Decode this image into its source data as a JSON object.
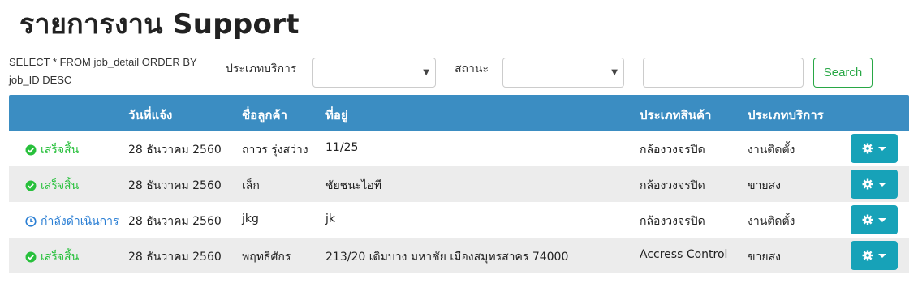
{
  "page": {
    "title": "รายการงาน Support"
  },
  "filters": {
    "sql": "SELECT * FROM job_detail ORDER BY job_ID DESC",
    "service_type_label": "ประเภทบริการ",
    "status_label": "สถานะ",
    "service_type_value": "",
    "status_value": "",
    "search_value": "",
    "search_button": "Search"
  },
  "table": {
    "headers": {
      "status": "",
      "date": "วันที่แจ้ง",
      "customer": "ชื่อลูกค้า",
      "address": "ที่อยู่",
      "product_type": "ประเภทสินค้า",
      "service_type": "ประเภทบริการ"
    },
    "rows": [
      {
        "status": "เสร็จสิ้น",
        "status_kind": "done",
        "date": "28 ธันวาคม 2560",
        "customer": "ถาวร รุ่งสว่าง",
        "address": "11/25",
        "product_type": "กล้องวงจรปิด",
        "service_type": "งานติดตั้ง"
      },
      {
        "status": "เสร็จสิ้น",
        "status_kind": "done",
        "date": "28 ธันวาคม 2560",
        "customer": "เล็ก",
        "address": "ชัยชนะไอที",
        "product_type": "กล้องวงจรปิด",
        "service_type": "ขายส่ง"
      },
      {
        "status": "กำลังดำเนินการ",
        "status_kind": "progress",
        "date": "28 ธันวาคม 2560",
        "customer": "jkg",
        "address": "jk",
        "product_type": "กล้องวงจรปิด",
        "service_type": "งานติดตั้ง"
      },
      {
        "status": "เสร็จสิ้น",
        "status_kind": "done",
        "date": "28 ธันวาคม 2560",
        "customer": "พฤทธิศักร",
        "address": "213/20 เดิมบาง มหาชัย เมืองสมุทรสาคร 74000",
        "product_type": "Accress Control",
        "service_type": "ขายส่ง"
      }
    ]
  },
  "colors": {
    "header_bg": "#3b8dc2",
    "done": "#28c03c",
    "progress": "#2b7fd4",
    "action_button": "#17a2b8",
    "search_button": "#28a745"
  },
  "icons": {
    "done": "check-circle-icon",
    "progress": "clock-icon",
    "action": "gear-icon",
    "dropdown": "caret-down-icon"
  }
}
